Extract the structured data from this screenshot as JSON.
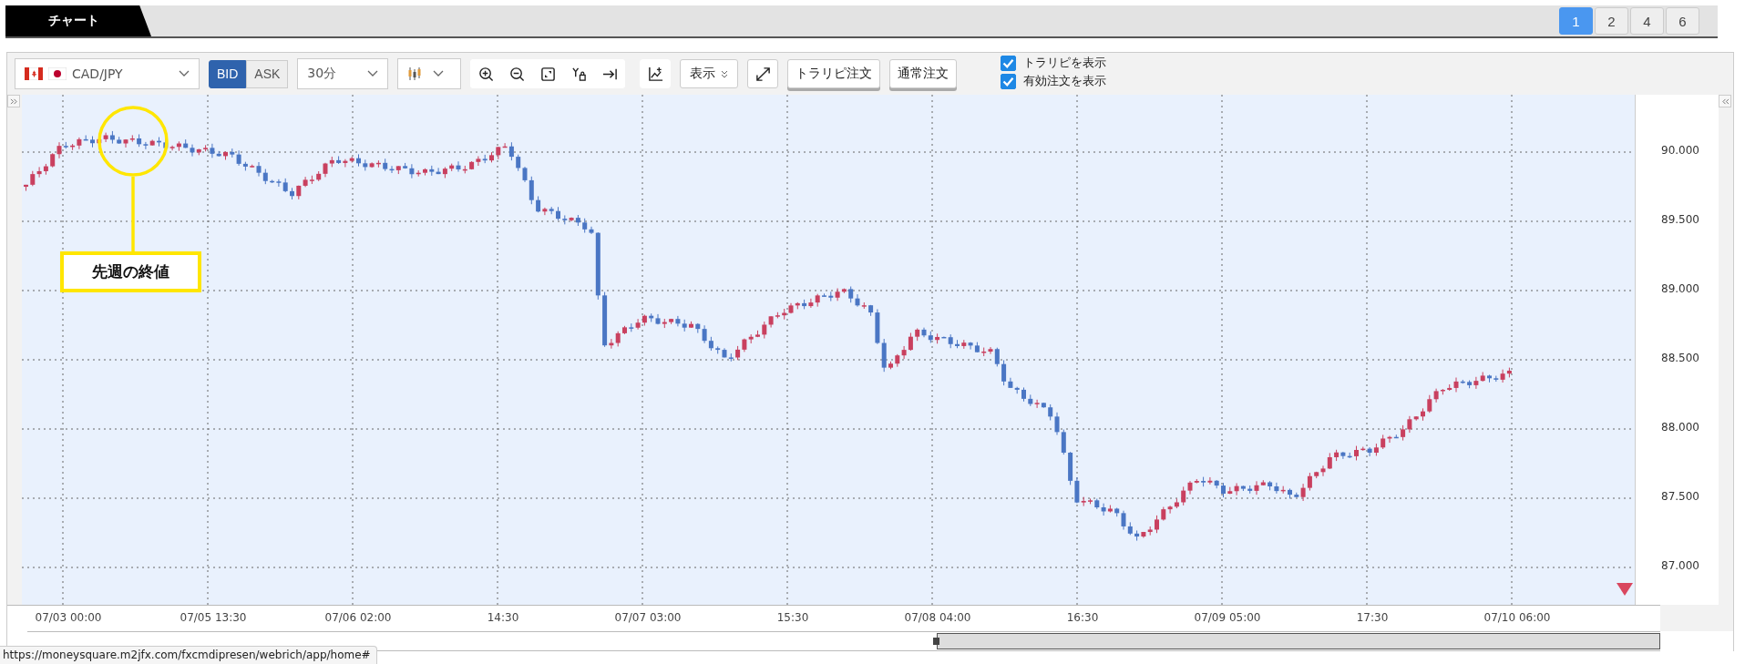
{
  "tabs": [
    {
      "label": "チャート",
      "selected": true
    }
  ],
  "layouts": [
    {
      "label": "1",
      "selected": true
    },
    {
      "label": "2",
      "selected": false
    },
    {
      "label": "4",
      "selected": false
    },
    {
      "label": "6",
      "selected": false
    }
  ],
  "toolbar": {
    "symbol": "CAD/JPY",
    "price_side": [
      {
        "label": "BID",
        "selected": true
      },
      {
        "label": "ASK",
        "selected": false
      }
    ],
    "timeframe": "30分",
    "display_button": "表示",
    "order_buttons": [
      "トラリピ注文",
      "通常注文"
    ],
    "options": [
      {
        "label": "トラリピを表示",
        "checked": true
      },
      {
        "label": "有効注文を表示",
        "checked": true
      }
    ]
  },
  "chart": {
    "annotation": "先週の終値",
    "y_labels": [
      "90.000",
      "89.500",
      "89.000",
      "88.500",
      "88.000",
      "87.500",
      "87.000"
    ],
    "x_labels": [
      "07/03 00:00",
      "07/05 13:30",
      "07/06 02:00",
      "14:30",
      "07/07 03:00",
      "15:30",
      "07/08 04:00",
      "16:30",
      "07/09 05:00",
      "17:30",
      "07/10 06:00"
    ]
  },
  "status_bar": "https://moneysquare.m2jfx.com/fxcmdipresen/webrich/app/home#"
}
